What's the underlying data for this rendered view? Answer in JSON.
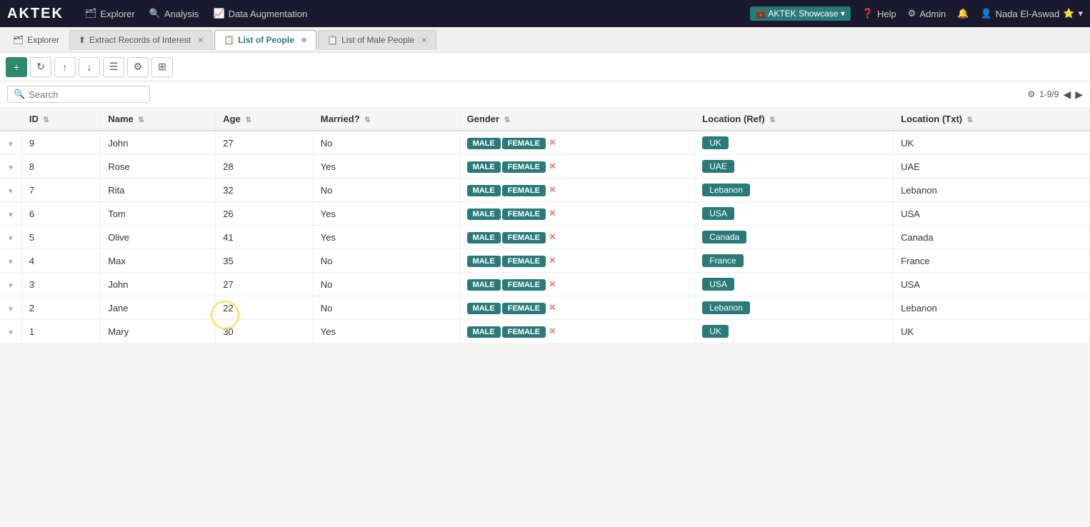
{
  "topNav": {
    "logo": "AKTEK",
    "items": [
      {
        "label": "Explorer",
        "icon": "🗂"
      },
      {
        "label": "Analysis",
        "icon": "🔍"
      },
      {
        "label": "Data Augmentation",
        "icon": "📈"
      }
    ],
    "right": {
      "brand": "AKTEK Showcase",
      "help": "Help",
      "admin": "Admin",
      "bell": "🔔",
      "user": "Nada El-Aswad",
      "star": "⭐"
    }
  },
  "tabs": [
    {
      "label": "Explorer",
      "icon": "🗂",
      "active": false,
      "closable": false
    },
    {
      "label": "Extract Records of Interest",
      "icon": "⬆",
      "active": false,
      "closable": true
    },
    {
      "label": "List of People",
      "icon": "📋",
      "active": true,
      "closable": true
    },
    {
      "label": "List of Male People",
      "icon": "📋",
      "active": false,
      "closable": true
    }
  ],
  "toolbar": {
    "buttons": [
      {
        "icon": "+",
        "label": "add",
        "green": true
      },
      {
        "icon": "↻",
        "label": "refresh"
      },
      {
        "icon": "↑",
        "label": "upload"
      },
      {
        "icon": "↓",
        "label": "download"
      },
      {
        "icon": "☰",
        "label": "list"
      },
      {
        "icon": "⚙",
        "label": "filter"
      },
      {
        "icon": "⊞",
        "label": "grid"
      }
    ]
  },
  "search": {
    "placeholder": "Search",
    "value": ""
  },
  "pagination": {
    "info": "1-9/9",
    "gearIcon": "⚙"
  },
  "table": {
    "columns": [
      {
        "key": "id",
        "label": "ID"
      },
      {
        "key": "name",
        "label": "Name"
      },
      {
        "key": "age",
        "label": "Age"
      },
      {
        "key": "married",
        "label": "Married?"
      },
      {
        "key": "gender",
        "label": "Gender"
      },
      {
        "key": "locationRef",
        "label": "Location (Ref)"
      },
      {
        "key": "locationTxt",
        "label": "Location (Txt)"
      }
    ],
    "rows": [
      {
        "id": 9,
        "name": "John",
        "age": 27,
        "married": "No",
        "gender": [
          "MALE",
          "FEMALE"
        ],
        "locationRef": "UK",
        "locationTxt": "UK"
      },
      {
        "id": 8,
        "name": "Rose",
        "age": 28,
        "married": "Yes",
        "gender": [
          "MALE",
          "FEMALE"
        ],
        "locationRef": "UAE",
        "locationTxt": "UAE"
      },
      {
        "id": 7,
        "name": "Rita",
        "age": 32,
        "married": "No",
        "gender": [
          "MALE",
          "FEMALE"
        ],
        "locationRef": "Lebanon",
        "locationTxt": "Lebanon"
      },
      {
        "id": 6,
        "name": "Tom",
        "age": 26,
        "married": "Yes",
        "gender": [
          "MALE",
          "FEMALE"
        ],
        "locationRef": "USA",
        "locationTxt": "USA"
      },
      {
        "id": 5,
        "name": "Olive",
        "age": 41,
        "married": "Yes",
        "gender": [
          "MALE",
          "FEMALE"
        ],
        "locationRef": "Canada",
        "locationTxt": "Canada"
      },
      {
        "id": 4,
        "name": "Max",
        "age": 35,
        "married": "No",
        "gender": [
          "MALE",
          "FEMALE"
        ],
        "locationRef": "France",
        "locationTxt": "France"
      },
      {
        "id": 3,
        "name": "John",
        "age": 27,
        "married": "No",
        "gender": [
          "MALE",
          "FEMALE"
        ],
        "locationRef": "USA",
        "locationTxt": "USA"
      },
      {
        "id": 2,
        "name": "Jane",
        "age": 22,
        "married": "No",
        "gender": [
          "MALE",
          "FEMALE"
        ],
        "locationRef": "Lebanon",
        "locationTxt": "Lebanon"
      },
      {
        "id": 1,
        "name": "Mary",
        "age": 30,
        "married": "Yes",
        "gender": [
          "MALE",
          "FEMALE"
        ],
        "locationRef": "UK",
        "locationTxt": "UK"
      }
    ]
  }
}
